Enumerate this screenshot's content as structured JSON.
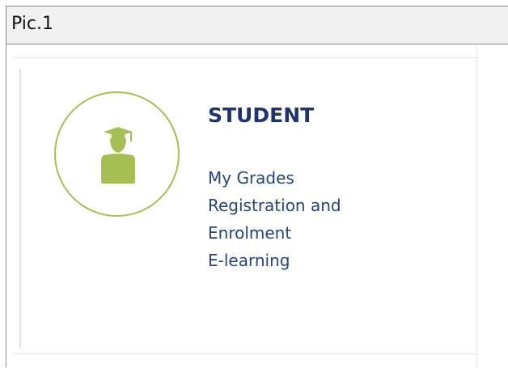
{
  "caption": "Pic.1",
  "panel": {
    "icon": "student-graduate-icon",
    "accent_color": "#a7be52",
    "title": "STUDENT",
    "title_color": "#1e3471",
    "links": [
      "My Grades",
      "Registration and",
      "Enrolment",
      "E-learning"
    ]
  }
}
